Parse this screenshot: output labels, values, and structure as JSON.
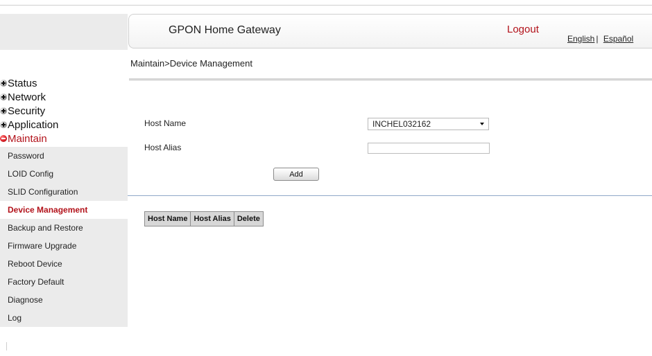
{
  "header": {
    "title": "GPON Home Gateway",
    "logout": "Logout",
    "lang_english": "English",
    "lang_separator": "|",
    "lang_spanish": "Español"
  },
  "breadcrumb": "Maintain>Device Management",
  "sidebar": {
    "categories": [
      {
        "label": "Status",
        "active": false
      },
      {
        "label": "Network",
        "active": false
      },
      {
        "label": "Security",
        "active": false
      },
      {
        "label": "Application",
        "active": false
      },
      {
        "label": "Maintain",
        "active": true
      }
    ],
    "items": [
      {
        "label": "Password"
      },
      {
        "label": "LOID Config"
      },
      {
        "label": "SLID Configuration"
      },
      {
        "label": "Device Management",
        "active": true
      },
      {
        "label": "Backup and Restore"
      },
      {
        "label": "Firmware Upgrade"
      },
      {
        "label": "Reboot Device"
      },
      {
        "label": "Factory Default"
      },
      {
        "label": "Diagnose"
      },
      {
        "label": "Log"
      }
    ]
  },
  "form": {
    "host_name_label": "Host Name",
    "host_name_value": "INCHEL032162",
    "host_alias_label": "Host Alias",
    "host_alias_value": "",
    "add_label": "Add"
  },
  "table": {
    "headers": [
      "Host Name",
      "Host Alias",
      "Delete"
    ]
  },
  "colors": {
    "accent": "#b2121a",
    "sidebar_bg": "#ebebeb",
    "table_header_bg": "#d7d7d7",
    "divider": "#8fa8c8"
  },
  "icons": {
    "category_collapsed": "plus-circle-icon",
    "category_expanded": "minus-circle-icon"
  }
}
